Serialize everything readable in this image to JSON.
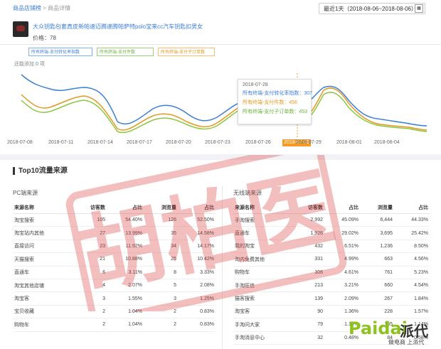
{
  "breadcrumb": {
    "root": "商品店铺榜",
    "sep": ">",
    "current": "商品详情"
  },
  "date_range": "最近1天（2018-08-06~2018-08-06）",
  "product": {
    "title": "大众钥匙包套真皮新帕速迈腾速腾帕萨特polo宝来cc汽车钥匙扣男女",
    "price": "价格：78"
  },
  "legend": [
    "所有终端-支付转化率指数",
    "所有终端-支付件数",
    "所有终端-支付子订单数"
  ],
  "compare": {
    "label": "还能添加",
    "count": "0",
    "unit": "项"
  },
  "tooltip": {
    "date": "2018-07-28",
    "l1": "所有终端-支付转化率指数：307",
    "l2": "所有终端-支付件数：456",
    "l3": "所有终端-支付子订单数：453"
  },
  "highlight_label": "2018-07-28",
  "chart_data": {
    "type": "line",
    "x": [
      "2018-07-08",
      "2018-07-11",
      "2018-07-14",
      "2018-07-17",
      "2018-07-20",
      "2018-07-23",
      "2018-07-26",
      "2018-07-29",
      "2018-08-01",
      "2018-08-04"
    ],
    "series": [
      {
        "name": "所有终端-支付转化率指数",
        "color": "#3d7fd6"
      },
      {
        "name": "所有终端-支付件数",
        "color": "#e09a20"
      },
      {
        "name": "所有终端-支付子订单数",
        "color": "#6bb33c"
      }
    ]
  },
  "section_title": "Top10流量来源",
  "pc": {
    "title": "PC端来源",
    "headers": [
      "来源名称",
      "访客数",
      "占比",
      "浏览量",
      "占比"
    ],
    "rows": [
      [
        "淘宝搜索",
        "105",
        "54.40%",
        "126",
        "52.50%"
      ],
      [
        "淘宝站内其他",
        "27",
        "13.99%",
        "35",
        "14.58%"
      ],
      [
        "直接访问",
        "23",
        "11.92%",
        "34",
        "14.17%"
      ],
      [
        "天猫搜索",
        "21",
        "10.88%",
        "25",
        "10.42%"
      ],
      [
        "直通车",
        "6",
        "3.11%",
        "8",
        "3.33%"
      ],
      [
        "淘宝其他店铺",
        "4",
        "2.07%",
        "5",
        "2.08%"
      ],
      [
        "淘宝客",
        "3",
        "1.55%",
        "3",
        "1.25%"
      ],
      [
        "宝贝收藏",
        "2",
        "1.04%",
        "2",
        "0.83%"
      ],
      [
        "购物车",
        "2",
        "1.04%",
        "2",
        "0.83%"
      ]
    ]
  },
  "mobile": {
    "title": "无线端来源",
    "headers": [
      "来源名称",
      "访客数",
      "占比",
      "浏览量",
      "占比"
    ],
    "rows": [
      [
        "手淘搜索",
        "2,992",
        "45.09%",
        "6,444",
        "44.33%"
      ],
      [
        "直通车",
        "1,926",
        "29.02%",
        "3,695",
        "25.42%"
      ],
      [
        "我的淘宝",
        "432",
        "6.51%",
        "1,236",
        "8.50%"
      ],
      [
        "淘内免费其他",
        "331",
        "4.99%",
        "663",
        "4.56%"
      ],
      [
        "购物车",
        "306",
        "4.61%",
        "761",
        "5.23%"
      ],
      [
        "手淘旺信",
        "213",
        "3.21%",
        "660",
        "4.54%"
      ],
      [
        "猫客搜索",
        "139",
        "2.09%",
        "267",
        "1.84%"
      ],
      [
        "淘宝客",
        "90",
        "1.36%",
        "228",
        "1.57%"
      ],
      [
        "手淘问大家",
        "79",
        "1.19%",
        "165",
        "1.14%"
      ],
      [
        "手淘消息中心",
        "32",
        "0.48%",
        "84",
        "0.58%"
      ]
    ]
  },
  "watermark": "胡柏医",
  "logo": {
    "brand": "Paidai",
    "cn": "派代",
    "slogan": "做电商 上派代"
  }
}
